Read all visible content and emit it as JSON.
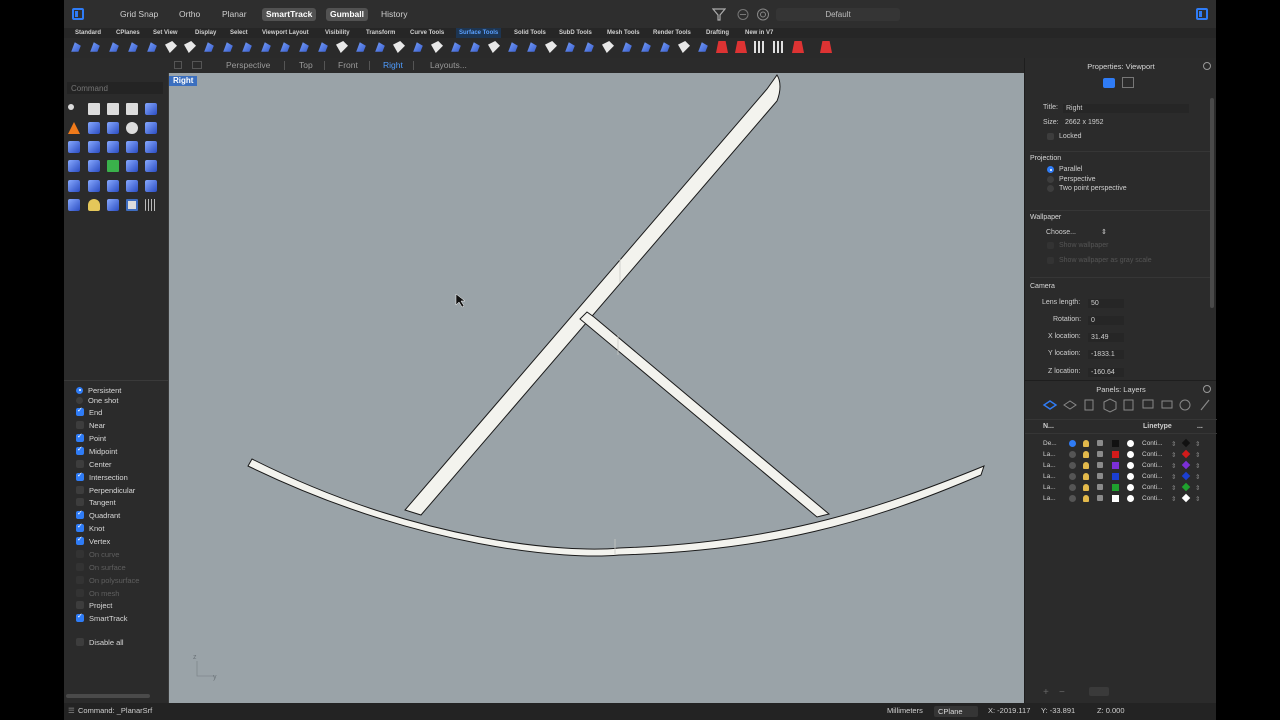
{
  "title_bar": {
    "buttons": [
      "Grid Snap",
      "Ortho",
      "Planar",
      "SmartTrack",
      "Gumball",
      "History"
    ],
    "active": [
      "SmartTrack",
      "Gumball"
    ],
    "display_mode": "Default"
  },
  "tab_bar": {
    "tabs": [
      "Standard",
      "CPlanes",
      "Set View",
      "Display",
      "Select",
      "Viewport Layout",
      "Visibility",
      "Transform",
      "Curve Tools",
      "Surface Tools",
      "Solid Tools",
      "SubD Tools",
      "Mesh Tools",
      "Render Tools",
      "Drafting",
      "New in V7"
    ],
    "selected": "Surface Tools"
  },
  "view_tabs": {
    "tabs": [
      "Perspective",
      "Top",
      "Front",
      "Right",
      "Layouts..."
    ],
    "selected": "Right"
  },
  "command_input": {
    "placeholder": "Command"
  },
  "viewport": {
    "label": "Right",
    "axis_z": "z",
    "axis_y": "y"
  },
  "osnap": {
    "mode_persistent": "Persistent",
    "mode_oneshot": "One shot",
    "items": [
      {
        "label": "End",
        "checked": true
      },
      {
        "label": "Near",
        "checked": false
      },
      {
        "label": "Point",
        "checked": true
      },
      {
        "label": "Midpoint",
        "checked": true
      },
      {
        "label": "Center",
        "checked": false
      },
      {
        "label": "Intersection",
        "checked": true
      },
      {
        "label": "Perpendicular",
        "checked": false
      },
      {
        "label": "Tangent",
        "checked": false
      },
      {
        "label": "Quadrant",
        "checked": true
      },
      {
        "label": "Knot",
        "checked": true
      },
      {
        "label": "Vertex",
        "checked": true
      },
      {
        "label": "On curve",
        "checked": false,
        "disabled": true
      },
      {
        "label": "On surface",
        "checked": false,
        "disabled": true
      },
      {
        "label": "On polysurface",
        "checked": false,
        "disabled": true
      },
      {
        "label": "On mesh",
        "checked": false,
        "disabled": true
      },
      {
        "label": "Project",
        "checked": false
      },
      {
        "label": "SmartTrack",
        "checked": true
      }
    ],
    "disable_all": "Disable all"
  },
  "properties": {
    "panel_title": "Properties: Viewport",
    "title_label": "Title:",
    "title_value": "Right",
    "size_label": "Size:",
    "size_value": "2662 x 1952",
    "locked": "Locked",
    "projection_header": "Projection",
    "projection_options": [
      "Parallel",
      "Perspective",
      "Two point perspective"
    ],
    "projection_selected": "Parallel",
    "wallpaper_header": "Wallpaper",
    "wallpaper_choose": "Choose...",
    "show_wallpaper": "Show wallpaper",
    "show_wallpaper_gray": "Show wallpaper as gray scale",
    "camera_header": "Camera",
    "lens_length_label": "Lens length:",
    "lens_length_value": "50",
    "rotation_label": "Rotation:",
    "rotation_value": "0",
    "x_location_label": "X location:",
    "x_location_value": "31.49",
    "y_location_label": "Y location:",
    "y_location_value": "-1833.1",
    "z_location_label": "Z location:",
    "z_location_value": "-160.64"
  },
  "layers": {
    "panel_title": "Panels: Layers",
    "col_name": "N...",
    "col_linetype": "Linetype",
    "col_more": "...",
    "rows": [
      {
        "name": "De...",
        "color": "#111111",
        "linetype": "Conti...",
        "print_color": "#111111",
        "current": true
      },
      {
        "name": "La...",
        "color": "#d11b1b",
        "linetype": "Conti...",
        "print_color": "#d11b1b",
        "current": false
      },
      {
        "name": "La...",
        "color": "#7b2fd6",
        "linetype": "Conti...",
        "print_color": "#7b2fd6",
        "current": false
      },
      {
        "name": "La...",
        "color": "#1b3fd1",
        "linetype": "Conti...",
        "print_color": "#1b3fd1",
        "current": false
      },
      {
        "name": "La...",
        "color": "#1fa12e",
        "linetype": "Conti...",
        "print_color": "#1fa12e",
        "current": false
      },
      {
        "name": "La...",
        "color": "#ffffff",
        "linetype": "Conti...",
        "print_color": "#ffffff",
        "current": false
      }
    ]
  },
  "status": {
    "command": "Command: _PlanarSrf",
    "units": "Millimeters",
    "cplane": "CPlane",
    "x": "X: -2019.117",
    "y": "Y: -33.891",
    "z": "Z: 0.000"
  },
  "colors": {
    "accent": "#2f7cf6",
    "viewport_bg": "#9aa3a8"
  }
}
